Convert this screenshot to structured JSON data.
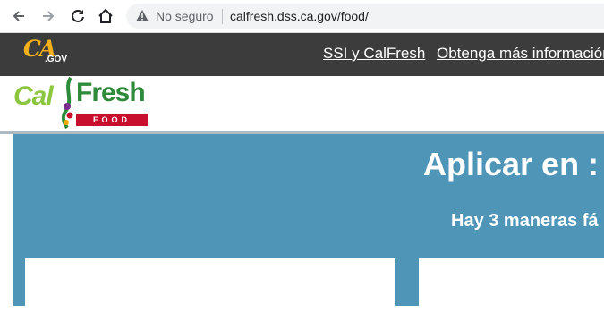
{
  "browser": {
    "security_label": "No seguro",
    "url": "calfresh.dss.ca.gov/food/",
    "icons": [
      "back-arrow-icon",
      "forward-arrow-icon",
      "reload-icon",
      "home-icon",
      "warning-icon"
    ]
  },
  "ca_bar": {
    "logo_ca": "CA",
    "logo_gov": ".GOV",
    "links": [
      "SSI y CalFresh",
      "Obtenga más información"
    ]
  },
  "calfresh_logo": {
    "cal": "Cal",
    "fresh": "Fresh",
    "food": "FOOD"
  },
  "apply": {
    "title": "Aplicar en :",
    "subtitle": "Hay 3 maneras fá"
  },
  "colors": {
    "dark_bar": "#3c3c3c",
    "ca_gold": "#f2b11b",
    "apply_blue": "#4e95b8",
    "calfresh_green": "#2e8b3a",
    "food_red": "#c8102e"
  }
}
